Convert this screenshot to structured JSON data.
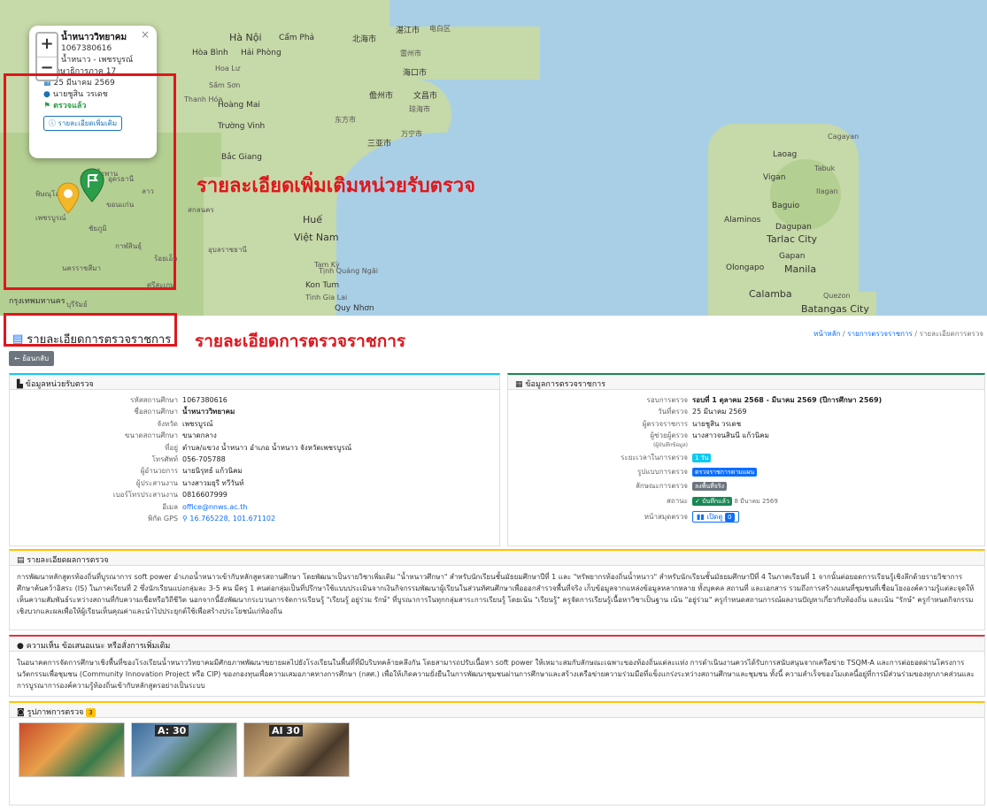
{
  "map": {
    "cities": [
      "Hà Nội",
      "Hải Phòng",
      "Hòa Bình",
      "Cẩm Phả",
      "Hoa Lư",
      "Sầm Sơn",
      "Thanh Hóa",
      "Hoàng Mai",
      "Trường Vinh",
      "Bắc Giang",
      "Huế",
      "Việt Nam",
      "Tam Kỳ",
      "Kon Tum",
      "Tịnh Quảng Ngãi",
      "Tình Gia Lai",
      "Quy Nhơn",
      "湛江市",
      "北海市",
      "海口市",
      "儋州市",
      "文昌市",
      "琼海市",
      "东方市",
      "万宁市",
      "三亚市",
      "电白区",
      "雷州市",
      "Laoag",
      "Tabuk",
      "Vigan",
      "Ilagan",
      "Baguio",
      "Dagupan",
      "Alaminos",
      "Tarlac City",
      "Gapan",
      "Olongapo",
      "Manila",
      "Calamba",
      "Quezon",
      "Batangas City",
      "Cagayan",
      "น้ำพาน",
      "อุดรธานี",
      "พิษณุโลก",
      "ลาว",
      "สกลนคร",
      "อุบลราชธานี",
      "เพชรบูรณ์",
      "ชัยภูมิ",
      "กาฬสินธุ์",
      "ขอนแก่น",
      "นครราชสีมา",
      "ร้อยเอ็ด",
      "ศรีสะเกษ",
      "กรุงเทพมหานคร",
      "บุรีรัมย์"
    ],
    "zoom_in": "+",
    "zoom_out": "−"
  },
  "popup": {
    "title": "น้ำหนาววิทยาคม",
    "code": "1067380616",
    "district": "น้ำหนาว - เพชรบูรณ์",
    "area": "ศึกษาธิการภาค 17",
    "date": "25 มีนาคม 2569",
    "inspector": "นายชูสิน วรเดช",
    "status": "ตรวจแล้ว",
    "more_button": "รายละเอียดเพิ่มเติม",
    "close": "×"
  },
  "annotations": {
    "map_label": "รายละเอียดเพิ่มเติมหน่วยรับตรวจ",
    "page_label": "รายละเอียดการตรวจราชการ"
  },
  "page": {
    "title": "รายละเอียดการตรวจราชการ",
    "breadcrumb": [
      "หน้าหลัก",
      "รายการตรวจราชการ",
      "รายละเอียดการตรวจ"
    ],
    "back": "← ย้อนกลับ"
  },
  "unit": {
    "header": "ข้อมูลหน่วยรับตรวจ",
    "rows": [
      {
        "k": "รหัสสถานศึกษา",
        "v": "1067380616"
      },
      {
        "k": "ชื่อสถานศึกษา",
        "v": "น้ำหนาววิทยาคม"
      },
      {
        "k": "จังหวัด",
        "v": "เพชรบูรณ์"
      },
      {
        "k": "ขนาดสถานศึกษา",
        "v": "ขนาดกลาง"
      },
      {
        "k": "ที่อยู่",
        "v": "ตำบล/แขวง น้ำหนาว อำเภอ น้ำหนาว จังหวัดเพชรบูรณ์"
      },
      {
        "k": "โทรศัพท์",
        "v": "056-705788"
      },
      {
        "k": "ผู้อำนวยการ",
        "v": "นายนิรุทธ์ แก้วนิคม"
      },
      {
        "k": "ผู้ประสานงาน",
        "v": "นางสาวมยุรี ทวีวันท์"
      },
      {
        "k": "เบอร์โทรประสานงาน",
        "v": "0816607999"
      },
      {
        "k": "อีเมล",
        "v": "office@nnws.ac.th"
      },
      {
        "k": "พิกัด GPS",
        "v": "16.765228, 101.671102"
      }
    ]
  },
  "inspection": {
    "header": "ข้อมูลการตรวจราชการ",
    "round_k": "รอบการตรวจ",
    "round_v": "รอบที่ 1 ตุลาคม 2568 - มีนาคม 2569 (ปีการศึกษา 2569)",
    "date_k": "วันที่ตรวจ",
    "date_v": "25 มีนาคม 2569",
    "inspector_k": "ผู้ตรวจราชการ",
    "inspector_v": "นายชูสิน วรเดช",
    "assistant_k": "ผู้ช่วยผู้ตรวจ",
    "assistant_v": "นางสาวจนสินนี แก้วนิคม",
    "assistant_sub": "(ผู้บันทึกข้อมูล)",
    "duration_k": "ระยะเวลาในการตรวจ",
    "duration_v": "1 วัน",
    "format_k": "รูปแบบการตรวจ",
    "format_v": "ตรวจราชการตามแผน",
    "nature_k": "ลักษณะการตรวจ",
    "nature_v": "ลงพื้นที่จริง",
    "status_k": "สถานะ",
    "status_v": "บันทึกแล้ว",
    "status_date": "8 มีนาคม 2569",
    "doc_k": "หน้าสมุดตรวจ",
    "doc_btn": "เปิดดู",
    "doc_count": "0"
  },
  "result": {
    "header": "รายละเอียดผลการตรวจ",
    "text": "การพัฒนาหลักสูตรท้องถิ่นที่บูรณาการ soft power อำเภอน้ำหนาวเข้ากับหลักสูตรสถานศึกษา โดยพัฒนาเป็นรายวิชาเพิ่มเติม \"น้ำหนาวศึกษา\" สำหรับนักเรียนชั้นมัธยมศึกษาปีที่ 1 และ \"ทรัพยากรท้องถิ่นน้ำหนาว\" สำหรับนักเรียนชั้นมัธยมศึกษาปีที่ 4 ในภาคเรียนที่ 1 จากนั้นต่อยอดการเรียนรู้เชิงลึกด้วยรายวิชาการศึกษาค้นคว้าอิสระ (IS) ในภาคเรียนที่ 2 ซึ่งนักเรียนแบ่งกลุ่มละ 3-5 คน มีครู 1 คนต่อกลุ่มเป็นที่ปรึกษาใช้แบบประเมินจากเงินกิจกรรมพัฒนาผู้เรียนในส่วนทัศนศึกษาเพื่อออกสำรวจพื้นที่จริง เก็บข้อมูลจากแหล่งข้อมูลหลากหลาย ทั้งบุคคล สถานที่ และเอกสาร รวมถึงการสร้างแผนที่ชุมชนที่เชื่อมโยงองค์ความรู้แต่ละจุดให้เห็นความสัมพันธ์ระหว่างสถานที่กับความเชื่อหรือวิถีชีวิต นอกจากนี้ยังพัฒนากระบวนการจัดการเรียนรู้ \"เรียนรู้ อยู่ร่วม รักษ์\" ที่บูรณาการในทุกกลุ่มสาระการเรียนรู้ โดยเน้น \"เรียนรู้\" ครูจัดการเรียนรู้เนื้อหาวิชาเป็นฐาน เน้น \"อยู่ร่วม\" ครูกำหนดสถานการณ์ผลงานปัญหาเกี่ยวกับท้องถิ่น และเน้น \"รักษ์\" ครูกำหนดกิจกรรมเชิงบวกและผลเพื่อให้ผู้เรียนเห็นคุณค่าและนำไปประยุกต์ใช้เพื่อสร้างประโยชน์แก่ท้องถิ่น"
  },
  "opinion": {
    "header": "ความเห็น ข้อเสนอแนะ หรือสั่งการเพิ่มเติม",
    "text": "ในอนาคตการจัดการศึกษาเชิงพื้นที่ของโรงเรียนน้ำหนาววิทยาคมมีศักยภาพพัฒนาขยายผลไปยังโรงเรียนในพื้นที่ที่มีบริบทคล้ายคลึงกัน โดยสามารถปรับเนื้อหา soft power ให้เหมาะสมกับลักษณะเฉพาะของท้องถิ่นแต่ละแห่ง การดำเนินงานควรได้รับการสนับสนุนจากเครือข่าย TSQM-A และการต่อยอดผ่านโครงการนวัตกรรมเพื่อชุมชน (Community Innovation Project หรือ CIP) ของกองทุนเพื่อความเสมอภาคทางการศึกษา (กสศ.) เพื่อให้เกิดความยั่งยืนในการพัฒนาชุมชนผ่านการศึกษาและสร้างเครือข่ายความร่วมมือที่แข็งแกร่งระหว่างสถานศึกษาและชุมชน ทั้งนี้ ความสำเร็จของโมเดลนี้อยู่ที่การมีส่วนร่วมของทุกภาคส่วนและการบูรณาการองค์ความรู้ท้องถิ่นเข้ากับหลักสูตรอย่างเป็นระบบ"
  },
  "photos": {
    "header": "รูปภาพการตรวจ",
    "count": "3",
    "signs": [
      "A: 30",
      "AI 30"
    ]
  },
  "colors": {
    "red": "#e0161c",
    "primary": "#0d6efd",
    "success": "#198754",
    "info": "#0dcaf0",
    "secondary": "#6c757d"
  }
}
